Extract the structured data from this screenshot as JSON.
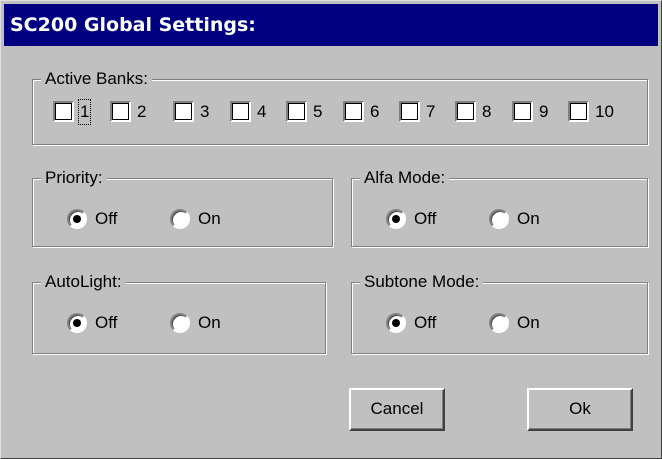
{
  "window": {
    "title": "SC200 Global Settings:"
  },
  "active_banks": {
    "legend": "Active Banks:",
    "banks": [
      {
        "label": "1",
        "checked": false,
        "focused": true
      },
      {
        "label": "2",
        "checked": false
      },
      {
        "label": "3",
        "checked": false
      },
      {
        "label": "4",
        "checked": false
      },
      {
        "label": "5",
        "checked": false
      },
      {
        "label": "6",
        "checked": false
      },
      {
        "label": "7",
        "checked": false
      },
      {
        "label": "8",
        "checked": false
      },
      {
        "label": "9",
        "checked": false
      },
      {
        "label": "10",
        "checked": false
      }
    ]
  },
  "priority": {
    "legend": "Priority:",
    "off_label": "Off",
    "on_label": "On",
    "selected": "Off"
  },
  "alfa_mode": {
    "legend": "Alfa Mode:",
    "off_label": "Off",
    "on_label": "On",
    "selected": "Off"
  },
  "autolight": {
    "legend": "AutoLight:",
    "off_label": "Off",
    "on_label": "On",
    "selected": "Off"
  },
  "subtone_mode": {
    "legend": "Subtone Mode:",
    "off_label": "Off",
    "on_label": "On",
    "selected": "Off"
  },
  "buttons": {
    "cancel": "Cancel",
    "ok": "Ok"
  }
}
